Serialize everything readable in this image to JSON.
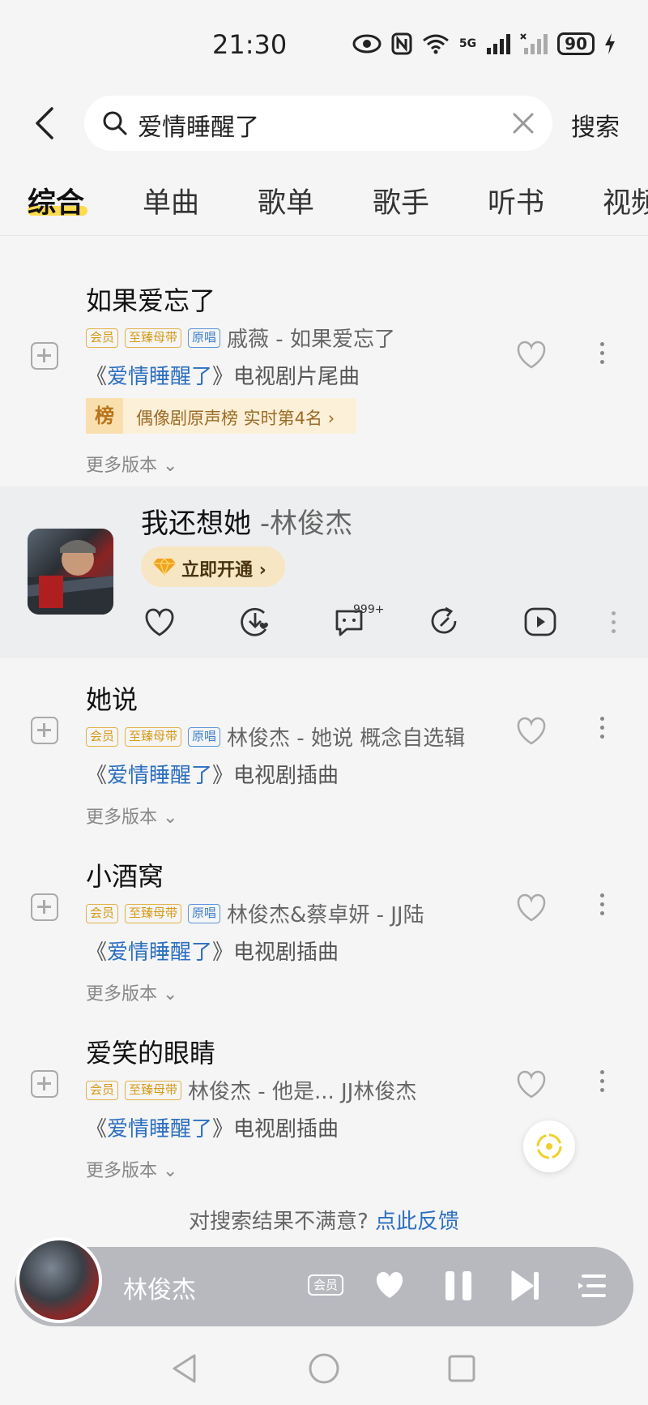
{
  "status_bar": {
    "time": "21:30",
    "network": "5G",
    "battery": "90"
  },
  "search": {
    "query": "爱情睡醒了",
    "button": "搜索"
  },
  "tabs": [
    {
      "label": "综合",
      "active": true
    },
    {
      "label": "单曲"
    },
    {
      "label": "歌单"
    },
    {
      "label": "歌手"
    },
    {
      "label": "听书"
    },
    {
      "label": "视频"
    }
  ],
  "tags": {
    "vip": "会员",
    "hifi": "至臻母带",
    "original": "原唱"
  },
  "songs": [
    {
      "title": "如果爱忘了",
      "artist": "戚薇 - 如果爱忘了",
      "desc_prefix": "《",
      "desc_highlight": "爱情睡醒了",
      "desc_suffix": "》电视剧片尾曲",
      "chart_icon": "榜",
      "chart": "偶像剧原声榜 实时第4名",
      "more": "更多版本"
    },
    {
      "title": "她说",
      "artist": "林俊杰 - 她说 概念自选辑",
      "desc_prefix": "《",
      "desc_highlight": "爱情睡醒了",
      "desc_suffix": "》电视剧插曲",
      "more": "更多版本"
    },
    {
      "title": "小酒窝",
      "artist": "林俊杰&蔡卓妍 - JJ陆",
      "desc_prefix": "《",
      "desc_highlight": "爱情睡醒了",
      "desc_suffix": "》电视剧插曲",
      "more": "更多版本"
    },
    {
      "title": "爱笑的眼睛",
      "artist": "林俊杰 - 他是... JJ林俊杰",
      "desc_prefix": "《",
      "desc_highlight": "爱情睡醒了",
      "desc_suffix": "》电视剧插曲",
      "more": "更多版本"
    }
  ],
  "now_playing": {
    "title": "我还想她",
    "artist": "-林俊杰",
    "vip_button": "立即开通",
    "comment_count": "999+"
  },
  "feedback": {
    "text": "对搜索结果不满意?",
    "link": "点此反馈"
  },
  "mini_player": {
    "name": "林俊杰",
    "vip": "会员"
  },
  "colors": {
    "accent_yellow": "#ffd83c",
    "link_blue": "#2d6fbf",
    "tag_gold": "#d49a16"
  }
}
